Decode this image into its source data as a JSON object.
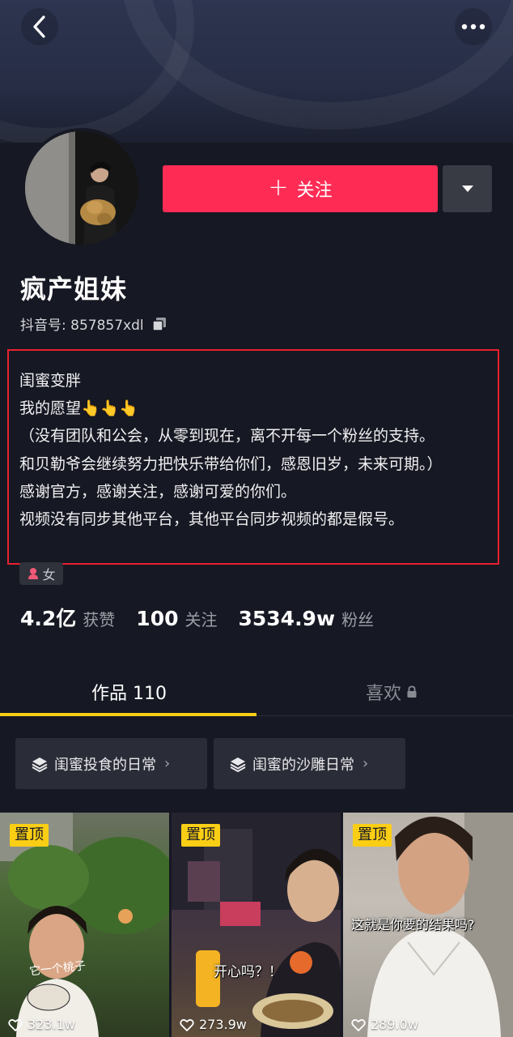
{
  "header": {
    "back_icon": "chevron-left-icon",
    "more_icon": "more-horizontal-icon"
  },
  "profile": {
    "name": "疯产姐妹",
    "id_label": "抖音号: 857857xdl",
    "follow_label": "关注",
    "gender": "女",
    "bio": {
      "line1": "闺蜜变胖",
      "line2": "我的愿望👆👆👆",
      "line3": "（没有团队和公会，从零到现在，离不开每一个粉丝的支持。",
      "line4": "和贝勒爷会继续努力把快乐带给你们，感恩旧岁，未来可期。）",
      "line5": "感谢官方，感谢关注，感谢可爱的你们。",
      "line6": "视频没有同步其他平台，其他平台同步视频的都是假号。"
    }
  },
  "stats": {
    "likes_num": "4.2亿",
    "likes_label": "获赞",
    "following_num": "100",
    "following_label": "关注",
    "followers_num": "3534.9w",
    "followers_label": "粉丝"
  },
  "tabs": {
    "works": "作品 110",
    "likes": "喜欢"
  },
  "collections": [
    {
      "label": "闺蜜投食的日常"
    },
    {
      "label": "闺蜜的沙雕日常"
    }
  ],
  "videos": [
    {
      "pin": "置顶",
      "likes": "323.1w",
      "caption": "它一个桃子"
    },
    {
      "pin": "置顶",
      "likes": "273.9w",
      "caption": "开心吗？！"
    },
    {
      "pin": "置顶",
      "likes": "289.0w",
      "caption": "这就是你要的结果吗?"
    }
  ],
  "colors": {
    "background": "#161823",
    "follow_button": "#fe2c55",
    "accent_yellow": "#face15",
    "highlight_box": "#e8212e"
  }
}
